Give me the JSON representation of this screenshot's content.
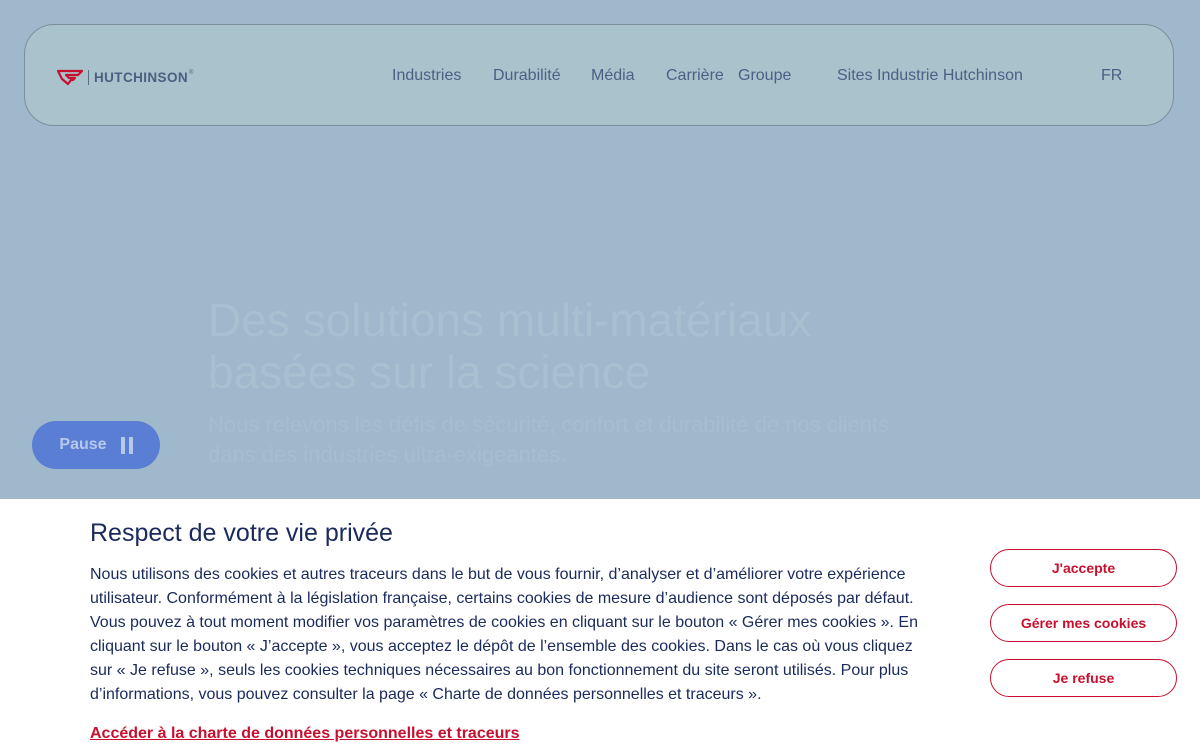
{
  "brand": {
    "name": "HUTCHINSON",
    "registered": "®",
    "logo_color": "#c8102e"
  },
  "nav": {
    "items": [
      {
        "label": "Industries"
      },
      {
        "label": "Durabilité"
      },
      {
        "label": "Média"
      },
      {
        "label": "Carrière"
      },
      {
        "label": "Groupe"
      },
      {
        "label": "Sites Industrie Hutchinson"
      }
    ],
    "language": "FR"
  },
  "hero": {
    "title": "Des solutions multi-matériaux basées sur la science",
    "subtitle": "Nous relevons les défis de sécurité, confort et durabilité de nos clients dans des industries ultra-exigeantes."
  },
  "carousel": {
    "pause_label": "Pause",
    "pause_icon": "pause-icon"
  },
  "cookie_banner": {
    "title": "Respect de votre vie privée",
    "text": "Nous utilisons des cookies et autres traceurs dans le but de vous fournir, d’analyser et d’améliorer votre expérience utilisateur. Conformément à la législation française, certains cookies de mesure d’audience sont déposés par défaut. Vous pouvez à tout moment modifier vos paramètres de cookies en cliquant sur le bouton « Gérer mes cookies ». En cliquant sur le bouton « J’accepte », vous acceptez le dépôt de l’ensemble des cookies. Dans le cas où vous cliquez sur « Je refuse », seuls les cookies techniques nécessaires au bon fonctionnement du site seront utilisés. Pour plus d’informations, vous pouvez consulter la page « Charte de données personnelles et traceurs ».",
    "link": "Accéder à la charte de données personnelles et traceurs",
    "accept_label": "J'accepte",
    "manage_label": "Gérer mes cookies",
    "refuse_label": "Je refuse",
    "accent_color": "#c8102e"
  }
}
